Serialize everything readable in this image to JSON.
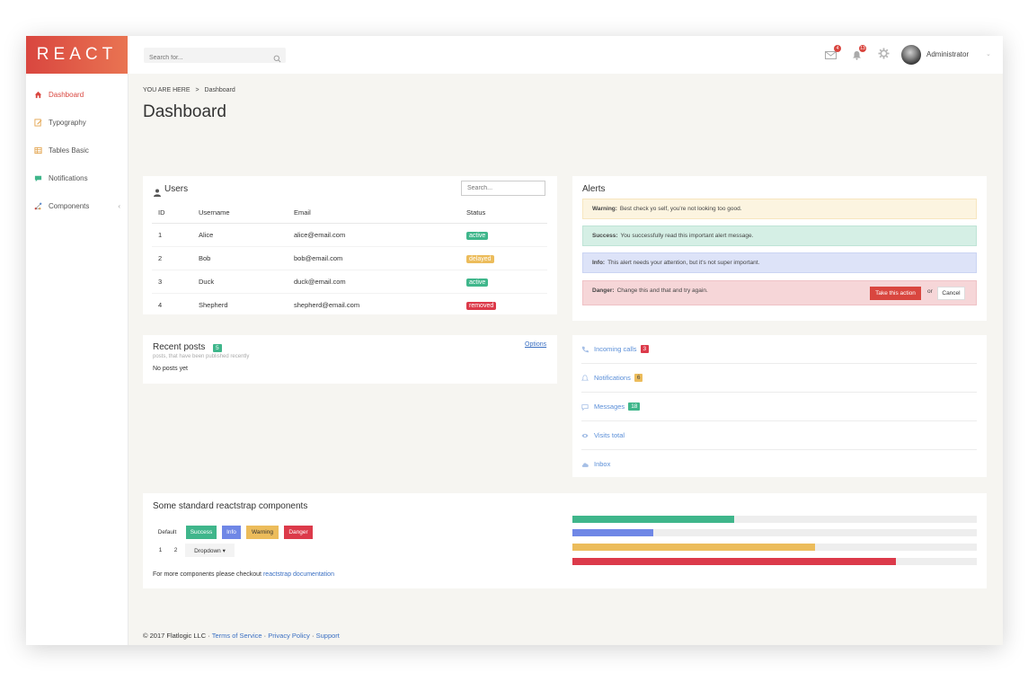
{
  "brand": {
    "logo": "REACT"
  },
  "sidebar": {
    "items": [
      {
        "label": "Dashboard",
        "icon": "home-icon",
        "active": true
      },
      {
        "label": "Typography",
        "icon": "edit-icon"
      },
      {
        "label": "Tables Basic",
        "icon": "table-icon"
      },
      {
        "label": "Notifications",
        "icon": "comment-icon"
      },
      {
        "label": "Components",
        "icon": "sitemap-icon",
        "chevron": "‹"
      }
    ]
  },
  "topbar": {
    "search_placeholder": "Search for...",
    "mail_count": "4",
    "bell_count": "13",
    "user_name": "Administrator",
    "caret": "⌄"
  },
  "breadcrumb": {
    "prefix": "YOU ARE HERE",
    "sep": ">",
    "current": "Dashboard"
  },
  "page_title": "Dashboard",
  "users": {
    "title": "Users",
    "search_placeholder": "Search...",
    "columns": [
      "ID",
      "Username",
      "Email",
      "Status"
    ],
    "rows": [
      {
        "id": "1",
        "username": "Alice",
        "email": "alice@email.com",
        "status": "active"
      },
      {
        "id": "2",
        "username": "Bob",
        "email": "bob@email.com",
        "status": "delayed"
      },
      {
        "id": "3",
        "username": "Duck",
        "email": "duck@email.com",
        "status": "active"
      },
      {
        "id": "4",
        "username": "Shepherd",
        "email": "shepherd@email.com",
        "status": "removed"
      }
    ]
  },
  "alerts": {
    "title": "Alerts",
    "warning": {
      "label": "Warning:",
      "text": "Best check yo self, you're not looking too good."
    },
    "success": {
      "label": "Success:",
      "text": "You successfully read this important alert message."
    },
    "info": {
      "label": "Info:",
      "text": "This alert needs your attention, but it's not super important."
    },
    "danger": {
      "label": "Danger:",
      "text": "Change this and that and try again."
    },
    "action_label": "Take this action",
    "or": "or",
    "cancel_label": "Cancel"
  },
  "recent_posts": {
    "title": "Recent posts",
    "count": "5",
    "subtitle": "posts, that have been published recently",
    "options": "Options",
    "empty": "No posts yet"
  },
  "stats": {
    "incoming_calls": {
      "label": "Incoming calls",
      "count": "3"
    },
    "notifications": {
      "label": "Notifications",
      "count": "6"
    },
    "messages": {
      "label": "Messages",
      "count": "18"
    },
    "visits": {
      "label": "Visits total"
    },
    "inbox": {
      "label": "Inbox"
    }
  },
  "components": {
    "title": "Some standard reactstrap components",
    "buttons": [
      "Default",
      "Success",
      "Info",
      "Warning",
      "Danger"
    ],
    "pagination": [
      "1",
      "2"
    ],
    "dropdown": "Dropdown",
    "more_text": "For more components please checkout",
    "more_link": "reactstrap documentation",
    "progress": [
      0.4,
      0.2,
      0.6,
      0.8
    ]
  },
  "footer": {
    "copyright": "© 2017 Flatlogic LLC",
    "dot": "·",
    "links": [
      "Terms of Service",
      "Privacy Policy",
      "Support"
    ]
  },
  "colors": {
    "accent": "#d9463f",
    "success": "#3fb68b",
    "info": "#6f87e6",
    "warning": "#ecbc5b",
    "danger": "#dc3a4a"
  }
}
